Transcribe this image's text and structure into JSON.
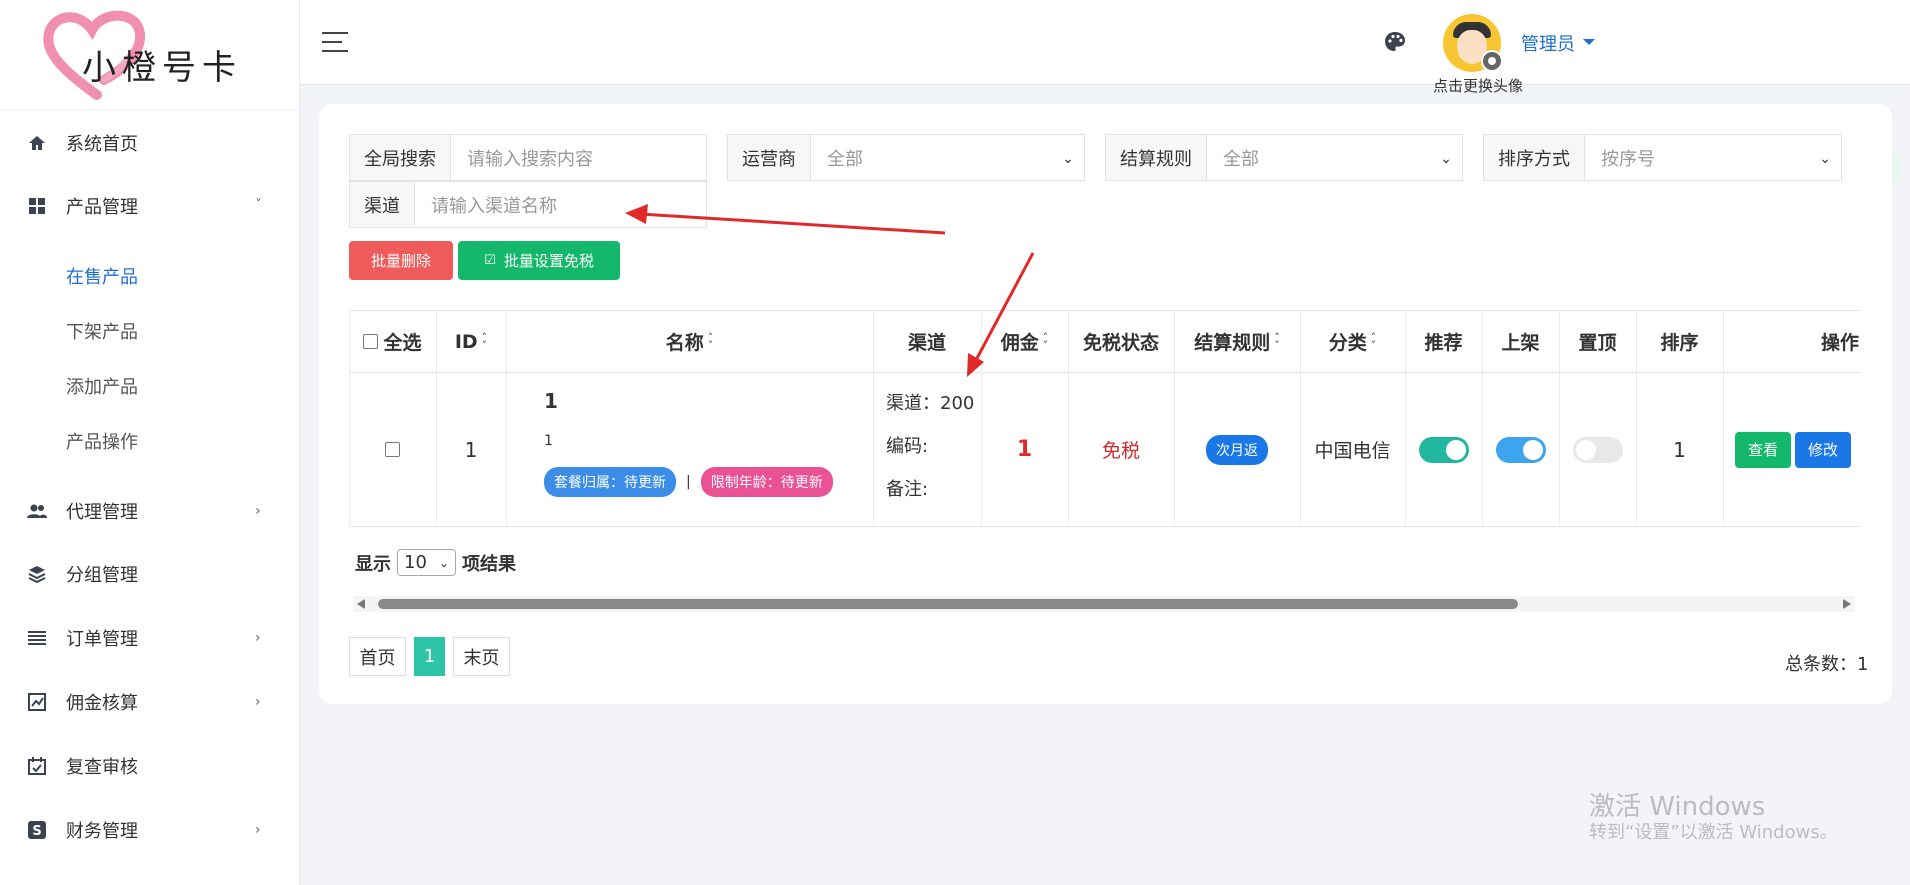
{
  "logo": {
    "text": "小橙号卡"
  },
  "sidebar": {
    "items": [
      {
        "label": "系统首页",
        "icon": "home-icon"
      },
      {
        "label": "产品管理",
        "icon": "grid-icon"
      },
      {
        "label": "代理管理",
        "icon": "users-icon"
      },
      {
        "label": "分组管理",
        "icon": "layers-icon"
      },
      {
        "label": "订单管理",
        "icon": "list-icon"
      },
      {
        "label": "佣金核算",
        "icon": "chart-icon"
      },
      {
        "label": "复查审核",
        "icon": "calendar-check-icon"
      },
      {
        "label": "财务管理",
        "icon": "dollar-icon"
      }
    ],
    "sub_items": [
      "在售产品",
      "下架产品",
      "添加产品",
      "产品操作"
    ]
  },
  "header": {
    "avatar_caption": "点击更换头像",
    "user_name": "管理员"
  },
  "filters": {
    "global_search": {
      "label": "全局搜索",
      "placeholder": "请输入搜索内容"
    },
    "operator": {
      "label": "运营商",
      "value": "全部"
    },
    "settle_rule": {
      "label": "结算规则",
      "value": "全部"
    },
    "sort": {
      "label": "排序方式",
      "value": "按序号"
    },
    "channel": {
      "label": "渠道",
      "placeholder": "请输入渠道名称"
    }
  },
  "buttons": {
    "batch_delete": "批量删除",
    "batch_tax_free": "批量设置免税"
  },
  "table": {
    "headers": {
      "select_all": "全选",
      "id": "ID",
      "name": "名称",
      "channel": "渠道",
      "commission": "佣金",
      "tax_status": "免税状态",
      "settle_rule": "结算规则",
      "category": "分类",
      "recommend": "推荐",
      "listed": "上架",
      "pinned": "置顶",
      "order": "排序",
      "actions": "操作"
    },
    "row": {
      "id": "1",
      "name_title": "1",
      "name_sub": "1",
      "tag_location": "套餐归属：待更新",
      "tag_separator": "|",
      "tag_age": "限制年龄：待更新",
      "channel_line": "渠道：200",
      "code_line": "编码:",
      "note_line": "备注:",
      "commission": "1",
      "tax_status": "免税",
      "settle_rule": "次月返",
      "category": "中国电信",
      "recommend": true,
      "listed": true,
      "pinned": false,
      "order": "1",
      "view_label": "查看",
      "edit_label": "修改"
    }
  },
  "page_size": {
    "prefix": "显示",
    "value": "10",
    "suffix": "项结果"
  },
  "pagination": {
    "first": "首页",
    "current": "1",
    "last": "末页",
    "total": "总条数：1"
  },
  "watermark": {
    "line1": "激活 Windows",
    "line2": "转到“设置”以激活 Windows。"
  },
  "colors": {
    "accent_blue": "#1f6fd1",
    "danger": "#ef5a5a",
    "success": "#14b86a",
    "teal": "#2ec4a6",
    "arrow_red": "#e02a2a"
  }
}
